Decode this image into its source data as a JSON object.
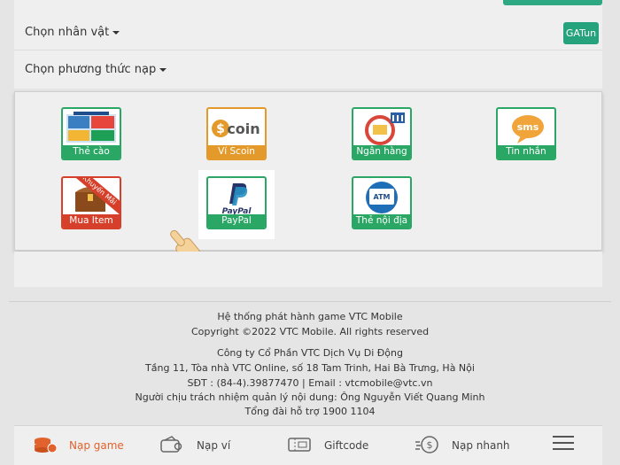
{
  "selects": {
    "character": "Chọn nhân vật",
    "payment": "Chọn phương thức nạp"
  },
  "gatun_label": "GATun",
  "methods": [
    {
      "label": "Thẻ cào",
      "icon": "scratch-card-icon"
    },
    {
      "label": "Ví Scoin",
      "icon": "scoin-wallet-icon",
      "art_text": "coin"
    },
    {
      "label": "Ngân hàng",
      "icon": "bank-icon"
    },
    {
      "label": "Tin nhắn",
      "icon": "sms-icon",
      "art_text": "sms"
    },
    {
      "label": "Mua Item",
      "icon": "treasure-chest-icon",
      "badge": "Khuyến Mãi"
    },
    {
      "label": "PayPal",
      "icon": "paypal-icon",
      "art_text": "PayPal"
    },
    {
      "label": "Thẻ nội địa",
      "icon": "atm-card-icon",
      "art_text": "ATM"
    }
  ],
  "footer": {
    "line1": "Hệ thống phát hành game VTC Mobile",
    "line2": "Copyright ©2022 VTC Mobile. All rights reserved",
    "line3": "Công ty Cổ Phần VTC Dịch Vụ Di Động",
    "line4": "Tầng 11, Tòa nhà VTC Online, số 18 Tam Trinh, Hai Bà Trưng, Hà Nội",
    "line5": "SĐT : (84-4).39877470 | Email : vtcmobile@vtc.vn",
    "line6": "Người chịu trách nhiệm quản lý nội dung: Ông Nguyễn Viết Quang Minh",
    "line7": "Tổng đài hỗ trợ 1900 1104"
  },
  "nav": [
    {
      "label": "Nạp game",
      "icon": "coins-stack-icon",
      "active": true
    },
    {
      "label": "Nạp ví",
      "icon": "wallet-icon"
    },
    {
      "label": "Giftcode",
      "icon": "ticket-icon"
    },
    {
      "label": "Nạp nhanh",
      "icon": "fast-coin-icon"
    }
  ],
  "colors": {
    "accent": "#2aa764",
    "active_nav": "#e1622c",
    "scoin": "#e39a2b",
    "promo": "#d6402a"
  }
}
